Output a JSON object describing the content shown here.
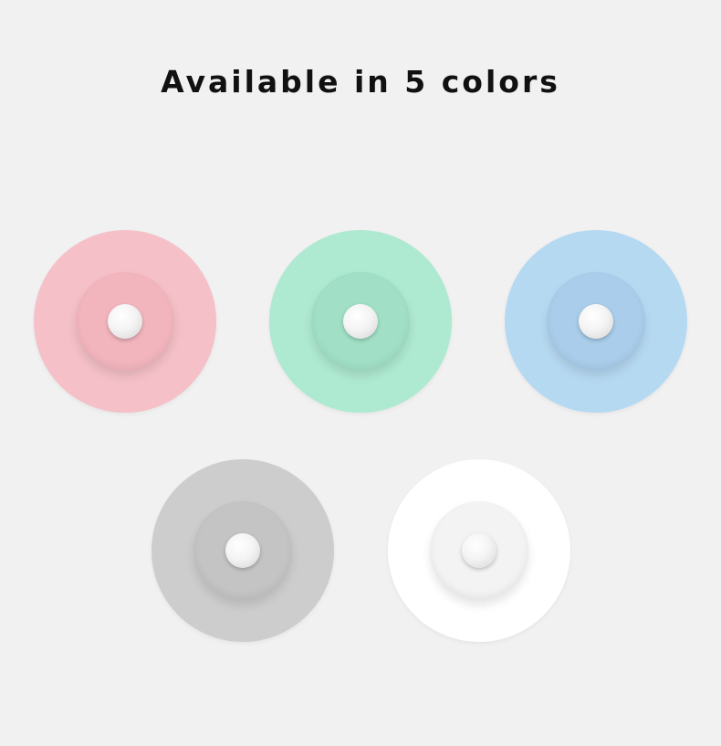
{
  "title": "Available in 5 colors",
  "colors": [
    {
      "name": "pink",
      "disc": "#f5c0c8",
      "dome": "#f2b5be"
    },
    {
      "name": "green",
      "disc": "#aee9d1",
      "dome": "#a1e0c6"
    },
    {
      "name": "blue",
      "disc": "#b6d9f2",
      "dome": "#a9cdea"
    },
    {
      "name": "gray",
      "disc": "#cdcdcd",
      "dome": "#c4c4c4"
    },
    {
      "name": "white",
      "disc": "#ffffff",
      "dome": "#f3f3f3"
    }
  ]
}
